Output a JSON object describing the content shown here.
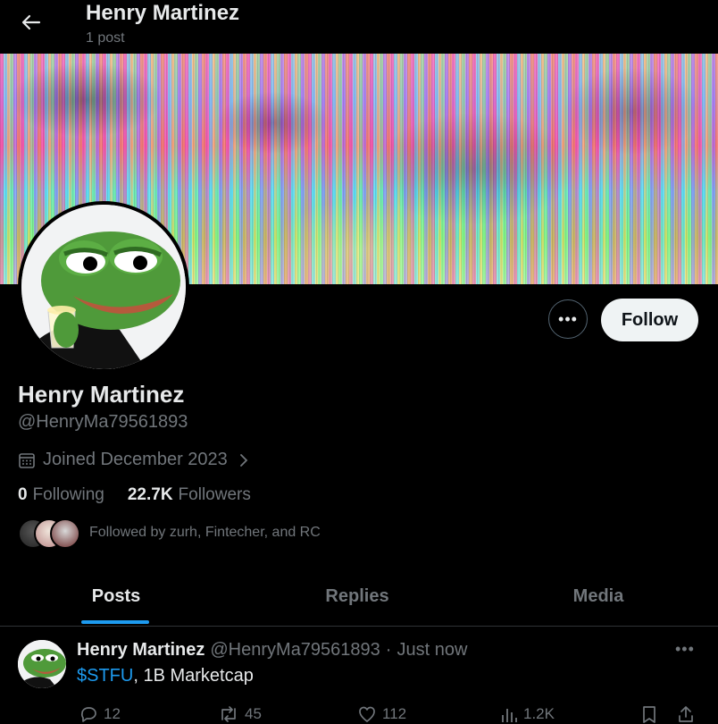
{
  "header": {
    "title": "Henry Martinez",
    "subtitle": "1 post"
  },
  "profile": {
    "name": "Henry Martinez",
    "handle": "@HenryMa79561893",
    "joined": "Joined December 2023",
    "following_count": "0",
    "following_label": "Following",
    "followers_count": "22.7K",
    "followers_label": "Followers",
    "followed_by": "Followed by zurh, Fintecher, and RC"
  },
  "actions": {
    "more_label": "•••",
    "follow_label": "Follow"
  },
  "tabs": [
    {
      "label": "Posts",
      "active": true
    },
    {
      "label": "Replies",
      "active": false
    },
    {
      "label": "Media",
      "active": false
    }
  ],
  "post": {
    "name": "Henry Martinez",
    "handle": "@HenryMa79561893",
    "separator": "·",
    "time": "Just now",
    "cashtag": "$STFU",
    "text_rest": ", 1B Marketcap",
    "replies": "12",
    "reposts": "45",
    "likes": "112",
    "views": "1.2K",
    "more_label": "•••"
  },
  "colors": {
    "background": "#000000",
    "text_primary": "#e7e9ea",
    "text_secondary": "#71767b",
    "accent": "#1d9bf0",
    "follow_button": "#eff3f4"
  },
  "icons": [
    "back-arrow-icon",
    "calendar-icon",
    "chevron-right-icon",
    "reply-icon",
    "repost-icon",
    "like-icon",
    "views-icon",
    "bookmark-icon",
    "share-icon"
  ]
}
